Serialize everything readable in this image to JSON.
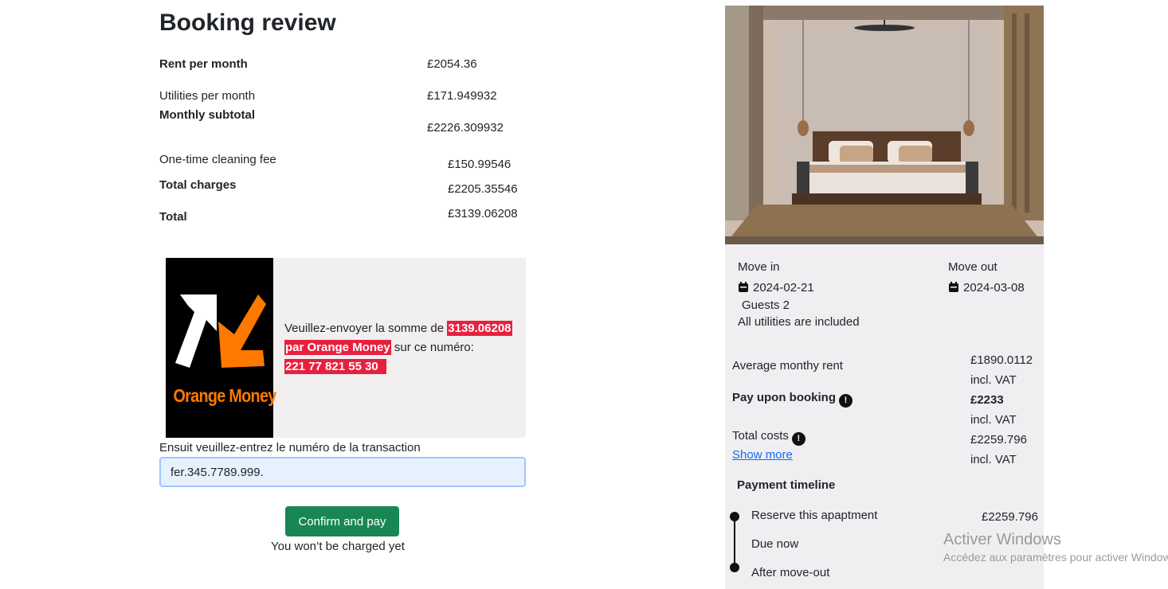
{
  "review": {
    "title": "Booking review",
    "rent_label": "Rent per month",
    "rent_value": "£2054.36",
    "utilities_label": "Utilities per month",
    "utilities_value": "£171.949932",
    "subtotal_label": "Monthly subtotal",
    "subtotal_value": "£2226.309932",
    "cleaning_label": "One-time cleaning fee",
    "cleaning_value": "£150.99546",
    "charges_label": "Total charges",
    "charges_value": "£2205.35546",
    "total_label": "Total",
    "total_value": "£3139.06208"
  },
  "payment": {
    "logo_text": "Orange Money",
    "msg_before": "Veuillez-envoyer la somme de ",
    "amount": "3139.06208",
    "method": "par Orange Money",
    "msg_after": " sur ce numéro:",
    "phone": "221 77 821 55 30",
    "transaction_label": "Ensuit veuillez-entrez le numéro de la transaction",
    "transaction_value": "fer.345.7789.999.",
    "confirm_label": "Confirm and pay",
    "note": "You won’t be charged yet",
    "colors": {
      "brand": "#ff7900",
      "highlight": "#e8203f",
      "button": "#198754"
    }
  },
  "listing": {
    "photo_icon": "bedroom-photo",
    "move_in_label": "Move in",
    "move_in_date": "2024-02-21",
    "move_out_label": "Move out",
    "move_out_date": "2024-03-08",
    "guests": "Guests 2",
    "utilities_note": "All utilities are included",
    "avg_rent_label": "Average monthy rent",
    "avg_rent_value": "£1890.0112",
    "avg_rent_vat": "incl. VAT",
    "pay_upon_label": "Pay upon booking",
    "pay_upon_value": "£2233",
    "pay_upon_vat": "incl. VAT",
    "total_costs_label": "Total costs",
    "total_costs_value": "£2259.796",
    "total_costs_vat": "incl. VAT",
    "show_more": "Show more",
    "timeline_title": "Payment timeline",
    "timeline": {
      "reserve_label": "Reserve this apaptment",
      "reserve_value": "£2259.796",
      "due_now_label": "Due now",
      "after_label": "After move-out"
    }
  },
  "watermark": {
    "line1": "Activer Windows",
    "line2": "Accédez aux paramètres pour activer Windows."
  }
}
